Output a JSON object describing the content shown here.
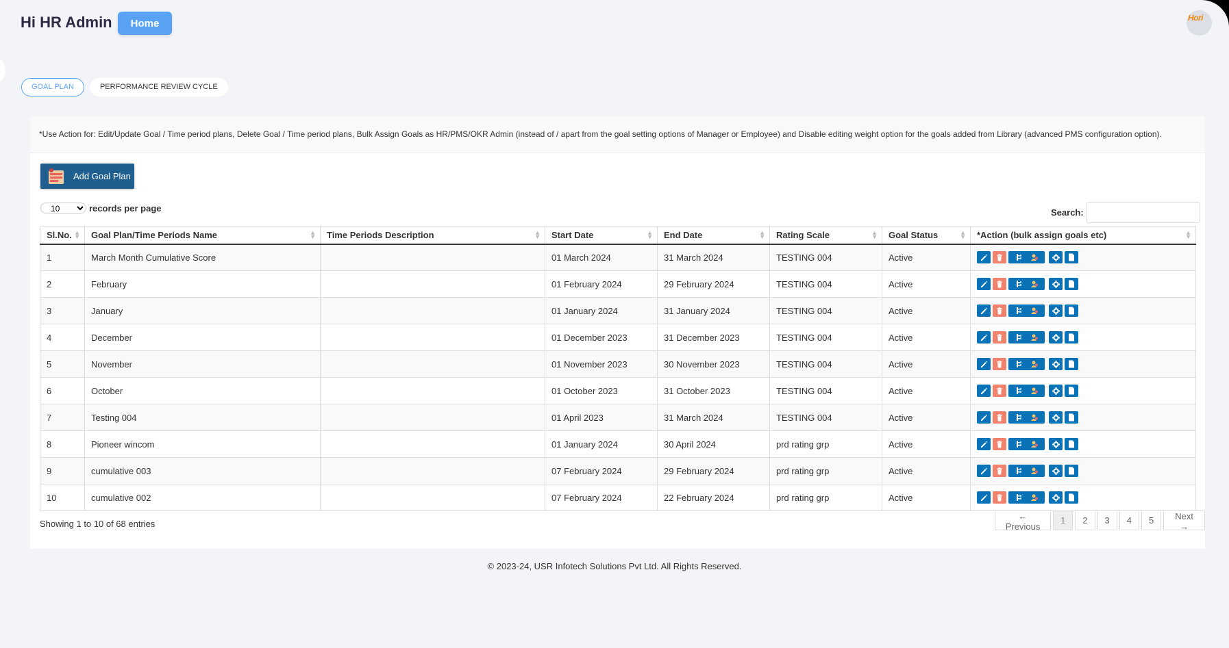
{
  "header": {
    "greeting": "Hi HR Admin",
    "home_label": "Home",
    "avatar_text": "Hori"
  },
  "tabs": [
    {
      "label": "GOAL PLAN",
      "active": true
    },
    {
      "label": "PERFORMANCE REVIEW CYCLE",
      "active": false
    }
  ],
  "note": "*Use Action for: Edit/Update Goal / Time period plans, Delete Goal / Time period plans, Bulk Assign Goals as HR/PMS/OKR Admin (instead of / apart from the goal setting options of Manager or Employee) and Disable editing weight option for the goals added from Library (advanced PMS configuration option).",
  "add_button": "Add Goal Plan",
  "length": {
    "value": "10",
    "label": "records per page"
  },
  "search": {
    "label": "Search:",
    "value": ""
  },
  "table": {
    "columns": [
      "Sl.No.",
      "Goal Plan/Time Periods Name",
      "Time Periods Description",
      "Start Date",
      "End Date",
      "Rating Scale",
      "Goal Status",
      "*Action (bulk assign goals etc)"
    ],
    "rows": [
      [
        "1",
        "March Month Cumulative Score",
        "",
        "01 March 2024",
        "31 March 2024",
        "TESTING 004",
        "Active"
      ],
      [
        "2",
        "February",
        "",
        "01 February 2024",
        "29 February 2024",
        "TESTING 004",
        "Active"
      ],
      [
        "3",
        "January",
        "",
        "01 January 2024",
        "31 January 2024",
        "TESTING 004",
        "Active"
      ],
      [
        "4",
        "December",
        "",
        "01 December 2023",
        "31 December 2023",
        "TESTING 004",
        "Active"
      ],
      [
        "5",
        "November",
        "",
        "01 November 2023",
        "30 November 2023",
        "TESTING 004",
        "Active"
      ],
      [
        "6",
        "October",
        "",
        "01 October 2023",
        "31 October 2023",
        "TESTING 004",
        "Active"
      ],
      [
        "7",
        "Testing 004",
        "",
        "01 April 2023",
        "31 March 2024",
        "TESTING 004",
        "Active"
      ],
      [
        "8",
        "Pioneer wincom",
        "",
        "01 January 2024",
        "30 April 2024",
        "prd rating grp",
        "Active"
      ],
      [
        "9",
        "cumulative 003",
        "",
        "07 February 2024",
        "29 February 2024",
        "prd rating grp",
        "Active"
      ],
      [
        "10",
        "cumulative 002",
        "",
        "07 February 2024",
        "22 February 2024",
        "prd rating grp",
        "Active"
      ]
    ],
    "action_icons": [
      "edit-icon",
      "delete-icon",
      "assign-goals-icon",
      "settings-icon",
      "document-icon"
    ]
  },
  "info": "Showing 1 to 10 of 68 entries",
  "pagination": {
    "previous": "← Previous",
    "pages": [
      "1",
      "2",
      "3",
      "4",
      "5"
    ],
    "current": "1",
    "next": "Next →"
  },
  "footer": "© 2023-24, USR Infotech Solutions Pvt Ltd. All Rights Reserved."
}
